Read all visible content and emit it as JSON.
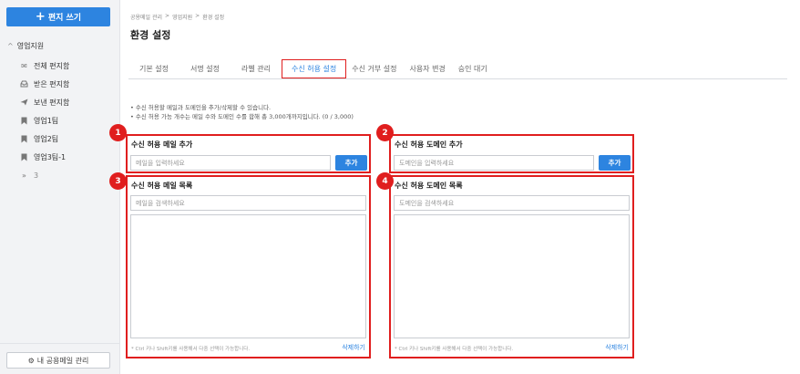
{
  "sidebar": {
    "compose_icon": "plus-icon",
    "compose_label": "편지 쓰기",
    "group_label": "영업지원",
    "items": [
      {
        "icon": "mail-icon",
        "label": "전체 편지함"
      },
      {
        "icon": "inbox-icon",
        "label": "받은 편지함"
      },
      {
        "icon": "send-icon",
        "label": "보낸 편지함"
      },
      {
        "icon": "bookmark-icon",
        "label": "영업1팀"
      },
      {
        "icon": "bookmark-icon",
        "label": "영업2팀"
      },
      {
        "icon": "bookmark-icon",
        "label": "영업3팀-1"
      }
    ],
    "more_count": "3",
    "manage_label": "내 공용메일 관리"
  },
  "breadcrumb": [
    "공용메일 관리",
    ">",
    "영업지원",
    ">",
    "환경 설정"
  ],
  "page_title": "환경 설정",
  "tabs": [
    "기본 설정",
    "서명 설정",
    "라벨 관리",
    "수신 허용 설정",
    "수신 거부 설정",
    "사용자 변경",
    "승인 대기"
  ],
  "active_tab": 3,
  "notes": [
    "수신 허용할 메일과 도메인을 추가/삭제할 수 있습니다.",
    "수신 허용 가능 개수는 메일 수와 도메인 수를 합해 총 3,000개까지입니다. (0 / 3,000)"
  ],
  "panels": {
    "add_email": {
      "badge": "1",
      "title": "수신 허용 메일 추가",
      "placeholder": "메일을 입력하세요",
      "button": "추가"
    },
    "add_domain": {
      "badge": "2",
      "title": "수신 허용 도메인 추가",
      "placeholder": "도메인을 입력하세요",
      "button": "추가"
    },
    "email_list": {
      "badge": "3",
      "title": "수신 허용 메일 목록",
      "placeholder": "메일을 검색하세요",
      "hint": "* Ctrl 키나 Shift키를 사용해서 다중 선택이 가능합니다.",
      "delete": "삭제하기"
    },
    "domain_list": {
      "badge": "4",
      "title": "수신 허용 도메인 목록",
      "placeholder": "도메인을 검색하세요",
      "hint": "* Ctrl 키나 Shift키를 사용해서 다중 선택이 가능합니다.",
      "delete": "삭제하기"
    }
  },
  "colors": {
    "accent": "#2d84e0",
    "highlight": "#e01e1e"
  }
}
